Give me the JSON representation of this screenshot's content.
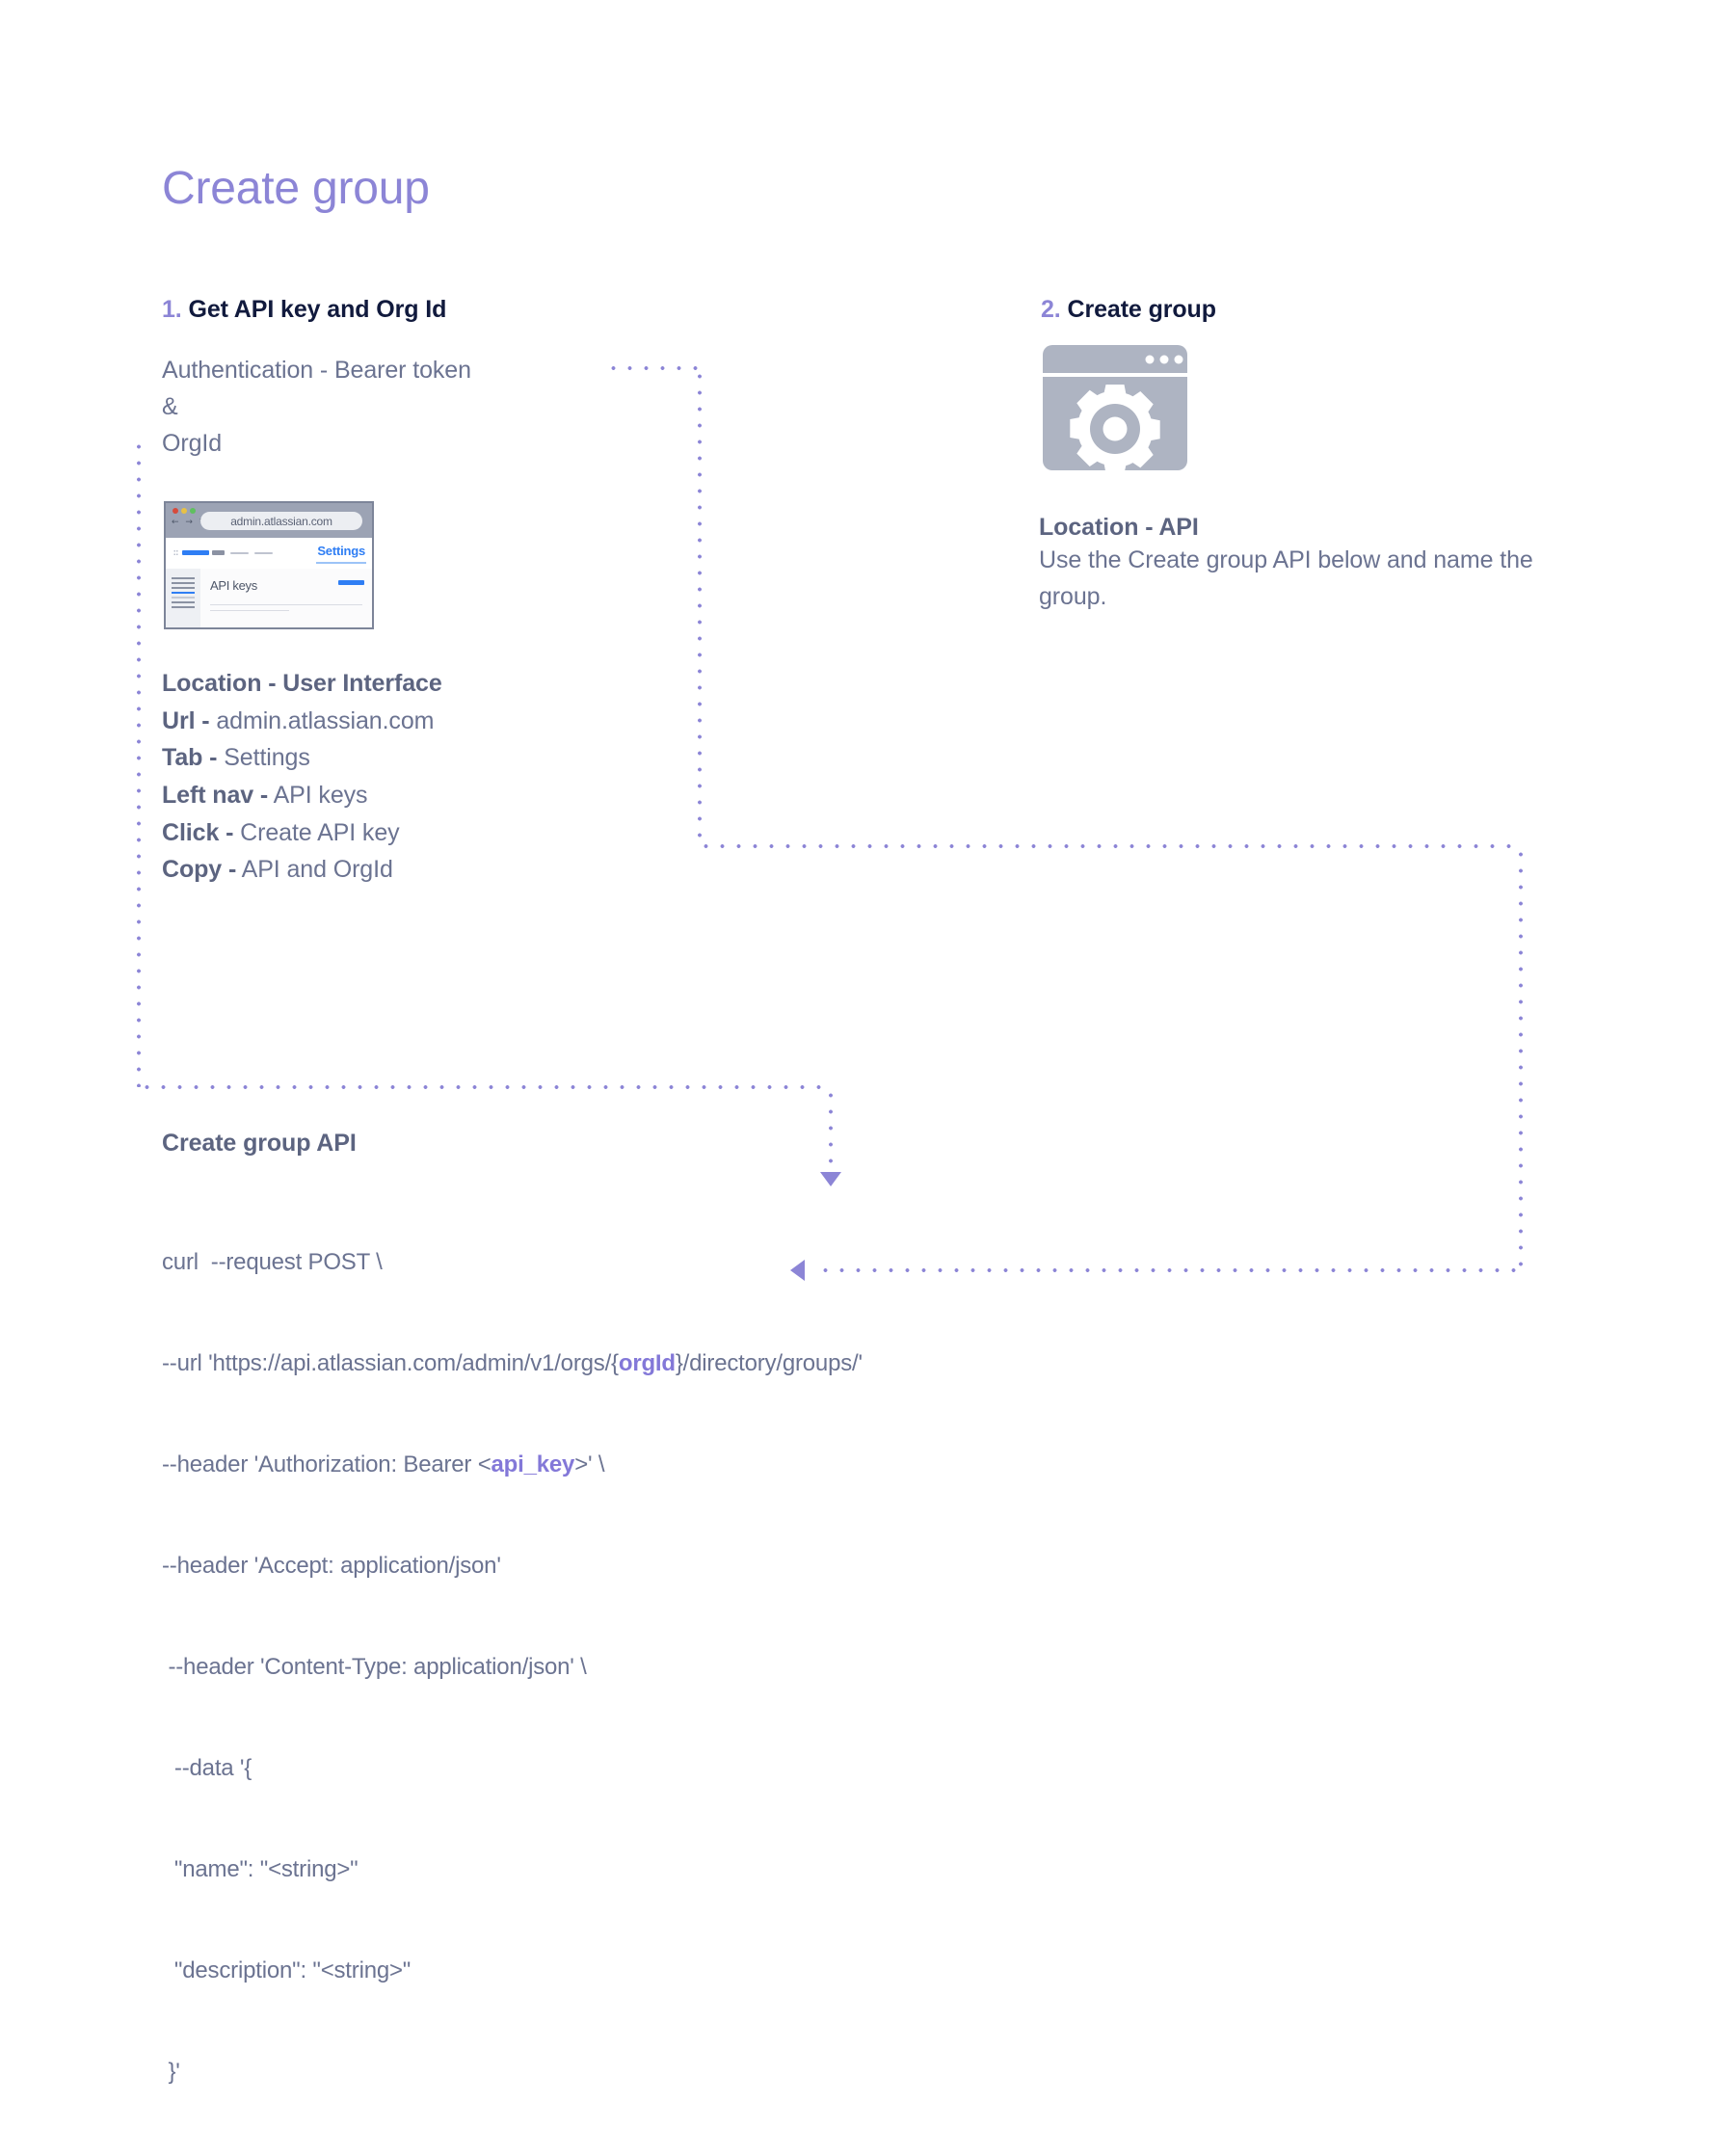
{
  "page": {
    "title": "Create group",
    "accent_purple": "#8c85d6",
    "heading_navy": "#111a3d",
    "body_gray": "#6b7391",
    "label_gray": "#5c6480",
    "blue": "#2f7ef4",
    "icon_gray": "#aeb4c2"
  },
  "step1": {
    "number": "1.",
    "title": "Get API key and Org Id",
    "auth_lines": [
      "Authentication - Bearer token",
      "&",
      "OrgId"
    ],
    "browser_mockup": {
      "url": "admin.atlassian.com",
      "tab_label": "Settings",
      "nav_item": "API keys",
      "traffic_lights": [
        "red",
        "yellow",
        "green"
      ],
      "nav_icons": "back-forward-reload"
    },
    "details": [
      {
        "label": "Location -",
        "value": " User Interface",
        "label_only": true
      },
      {
        "label": "Url -",
        "value": " admin.atlassian.com"
      },
      {
        "label": "Tab -",
        "value": " Settings"
      },
      {
        "label": "Left nav -",
        "value": " API keys"
      },
      {
        "label": "Click -",
        "value": " Create API key"
      },
      {
        "label": "Copy -",
        "value": " API and OrgId"
      }
    ]
  },
  "step2": {
    "number": "2.",
    "title": "Create group",
    "icon_name": "gear-window-icon",
    "location_heading": "Location - API",
    "description": "Use the Create group API below and name the group."
  },
  "api_block": {
    "heading": "Create group API",
    "lines": [
      {
        "text": "curl  --request POST \\"
      },
      {
        "pre": "--url 'https://api.atlassian.com/admin/v1/orgs/{",
        "hl": "orgId",
        "post": "}/directory/groups/'",
        "hl_open_brace": true
      },
      {
        "pre": "--header 'Authorization: Bearer <",
        "hl": "api_key",
        "post": ">' \\"
      },
      {
        "text": "--header 'Accept: application/json'"
      },
      {
        "text": " --header 'Content-Type: application/json' \\"
      },
      {
        "text": "  --data '{"
      },
      {
        "text": "  \"name\": \"<string>\""
      },
      {
        "text": "  \"description\": \"<string>\""
      },
      {
        "text": " }'"
      }
    ],
    "full_code": "curl  --request POST \\\n--url 'https://api.atlassian.com/admin/v1/orgs/{orgId}/directory/groups/'\n--header 'Authorization: Bearer <api_key>' \\\n--header 'Accept: application/json'\n --header 'Content-Type: application/json' \\\n  --data '{\n  \"name\": \"<string>\"\n  \"description\": \"<string>\"\n }'"
  },
  "connectors": {
    "arrow_down_target": "orgId",
    "arrow_left_target": "api_key",
    "style": "dotted-purple"
  }
}
